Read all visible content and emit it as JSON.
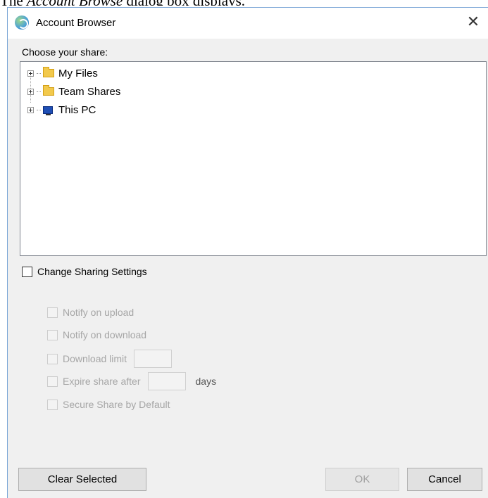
{
  "caption": {
    "prefix": "The ",
    "italic": "Account Browse",
    "suffix": " dialog box displays."
  },
  "window": {
    "title": "Account Browser",
    "close_glyph": "✕"
  },
  "choose_label": "Choose your share:",
  "tree": {
    "items": [
      {
        "label": "My Files",
        "icon": "folder-icon"
      },
      {
        "label": "Team Shares",
        "icon": "folder-icon"
      },
      {
        "label": "This PC",
        "icon": "computer-icon"
      }
    ]
  },
  "sharing": {
    "change_label": "Change Sharing Settings",
    "change_checked": false,
    "options": {
      "notify_upload": "Notify on upload",
      "notify_download": "Notify on download",
      "download_limit": "Download limit",
      "expire_after": "Expire share after",
      "days": "days",
      "secure_default": "Secure Share by Default"
    }
  },
  "buttons": {
    "clear": "Clear Selected",
    "ok": "OK",
    "cancel": "Cancel"
  }
}
